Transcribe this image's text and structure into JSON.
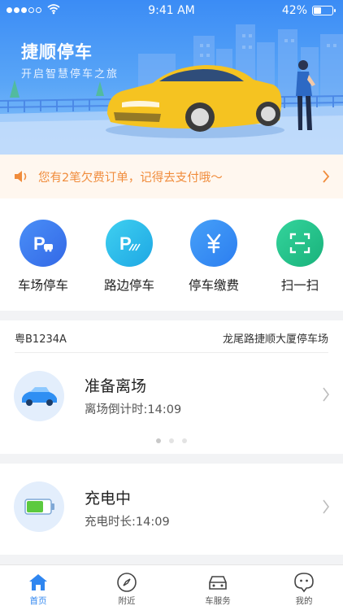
{
  "status_bar": {
    "time": "9:41 AM",
    "battery": "42%"
  },
  "hero": {
    "title": "捷顺停车",
    "subtitle": "开启智慧停车之旅"
  },
  "notice": {
    "text": "您有2笔欠费订单，记得去支付哦～"
  },
  "actions": [
    {
      "label": "车场停车",
      "icon": "parking-lot-icon",
      "color": "#3d7ef2"
    },
    {
      "label": "路边停车",
      "icon": "roadside-parking-icon",
      "color": "#27b9ea"
    },
    {
      "label": "停车缴费",
      "icon": "yuan-payment-icon",
      "color": "#2f8cf3"
    },
    {
      "label": "扫一扫",
      "icon": "scan-icon",
      "color": "#22c38e"
    }
  ],
  "parking": {
    "plate": "粤B1234A",
    "lot_name": "龙尾路捷顺大厦停车场",
    "status_title": "准备离场",
    "status_detail": "离场倒计时:14:09"
  },
  "charging": {
    "title": "充电中",
    "detail": "充电时长:14:09"
  },
  "tabs": [
    {
      "label": "首页",
      "icon": "home-icon",
      "active": true
    },
    {
      "label": "附近",
      "icon": "compass-icon",
      "active": false
    },
    {
      "label": "车服务",
      "icon": "car-service-icon",
      "active": false
    },
    {
      "label": "我的",
      "icon": "profile-icon",
      "active": false
    }
  ],
  "colors": {
    "accent": "#2f86f0",
    "notice": "#f08c3c",
    "hero_top": "#3b8cf5"
  }
}
